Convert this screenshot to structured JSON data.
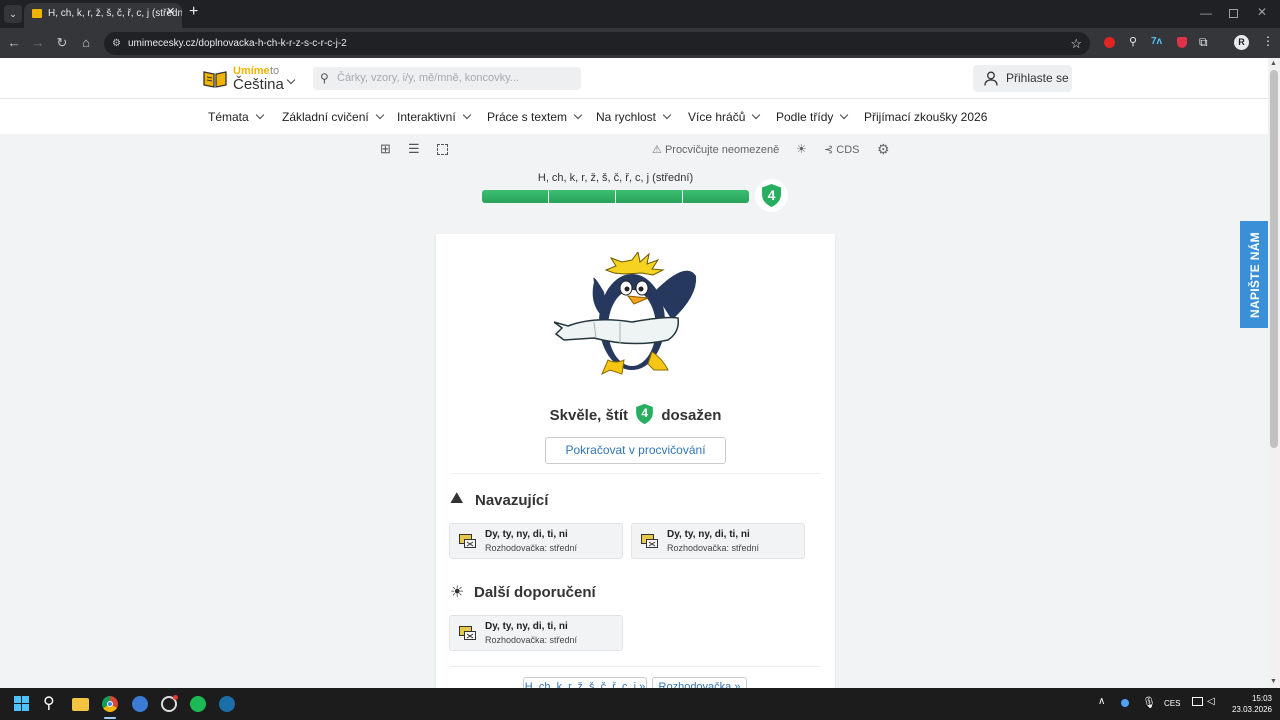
{
  "browser": {
    "tab_title": "H, ch, k, r, ž, š, č, ř, c, j (střední) ·",
    "url": "umimecesky.cz/doplnovacka-h-ch-k-r-z-s-c-r-c-j-2"
  },
  "header": {
    "logo_top": "Umíme",
    "logo_to": "to",
    "logo_bottom": "Čeština",
    "search_placeholder": "Čárky, vzory, i/y, mě/mně, koncovky...",
    "login_label": "Přihlaste se"
  },
  "nav": {
    "items": [
      {
        "label": "Témata"
      },
      {
        "label": "Základní cvičení"
      },
      {
        "label": "Interaktivní"
      },
      {
        "label": "Práce s textem"
      },
      {
        "label": "Na rychlost"
      },
      {
        "label": "Více hráčů"
      },
      {
        "label": "Podle třídy"
      },
      {
        "label": "Přijímací zkoušky 2026"
      }
    ]
  },
  "toolbar": {
    "unlimited_label": "Procvičujte neomezeně",
    "cds_label": "CDS"
  },
  "progress": {
    "title": "H, ch, k, r, ž, š, č, ř, c, j (střední)",
    "fill": 1.0,
    "segments": 4,
    "shield_level": "4"
  },
  "result": {
    "text_before": "Skvěle, štít",
    "shield_level": "4",
    "text_after": "dosažen",
    "continue_label": "Pokračovat v procvičování"
  },
  "related": {
    "title": "Navazující",
    "items": [
      {
        "title": "Dy, ty, ny, di, ti, ni",
        "subtitle": "Rozhodovačka: střední"
      },
      {
        "title": "Dy, ty, ny, di, ti, ni",
        "subtitle": "Rozhodovačka: střední"
      }
    ]
  },
  "recommend": {
    "title": "Další doporučení",
    "items": [
      {
        "title": "Dy, ty, ny, di, ti, ni",
        "subtitle": "Rozhodovačka: střední"
      }
    ]
  },
  "bottom_links": [
    "H, ch, k, r, ž, š, č, ř, c, j »",
    "Rozhodovačka »"
  ],
  "feedback_tab": "NAPIŠTE NÁM",
  "taskbar": {
    "language": "CES",
    "time": "15:03",
    "date": "23.03.2026"
  },
  "colors": {
    "accent_green": "#27ae60",
    "progress_green": "#33b36a",
    "feedback_blue": "#3a8fd6",
    "logo_yellow": "#f0b400"
  }
}
